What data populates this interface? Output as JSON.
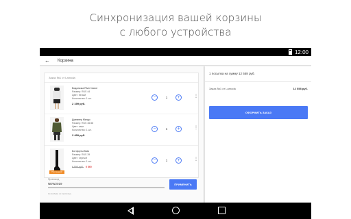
{
  "headline": {
    "line1": "Синхронизация вашей корзины",
    "line2": "с любого устройства"
  },
  "statusbar": {
    "time": "12:00"
  },
  "appbar": {
    "back_icon": "arrow-back-icon",
    "title": "Корзина"
  },
  "cart": {
    "order_label": "Заказ №1 от Lamoda",
    "items": [
      {
        "brand": "Водолазка River Island",
        "size": "Размер: RUS 44",
        "color": "Цвет: белый",
        "qty_label": "Количество: 1 шт.",
        "price": "2 199 руб.",
        "quantity": "1"
      },
      {
        "brand": "Джемпер Mango",
        "size": "Размер: RUS 46/48",
        "color": "Цвет: хаки",
        "qty_label": "Количество: 1 шт.",
        "price": "3 499 руб."
      },
      {
        "brand": "Ботфорты Bata",
        "size": "Размер: RUS 39",
        "color": "Цвет: черный",
        "qty_label": "Количество: 1 шт.",
        "old_price": "6 899 руб.",
        "new_price": "6 860",
        "badge": "Последний",
        "quantity": "1"
      }
    ],
    "stepper": {
      "minus": "−",
      "plus": "+"
    },
    "more_icon": "⋮",
    "item2_quantity": "1"
  },
  "promo": {
    "label": "Промокод",
    "value": "NEW2019",
    "note": "Не выбран ни промокод",
    "apply_label": "ПРИМЕНИТЬ"
  },
  "summary": {
    "title": "1 посылка на сумму 12 558 руб.",
    "order_label": "Заказ №1 от Lamoda",
    "order_amount": "12 558 руб.",
    "checkout_label": "ОФОРМИТЬ ЗАКАЗ"
  },
  "colors": {
    "accent": "#4a79f5",
    "badge": "#f08a24",
    "sale": "#e04b4b"
  }
}
